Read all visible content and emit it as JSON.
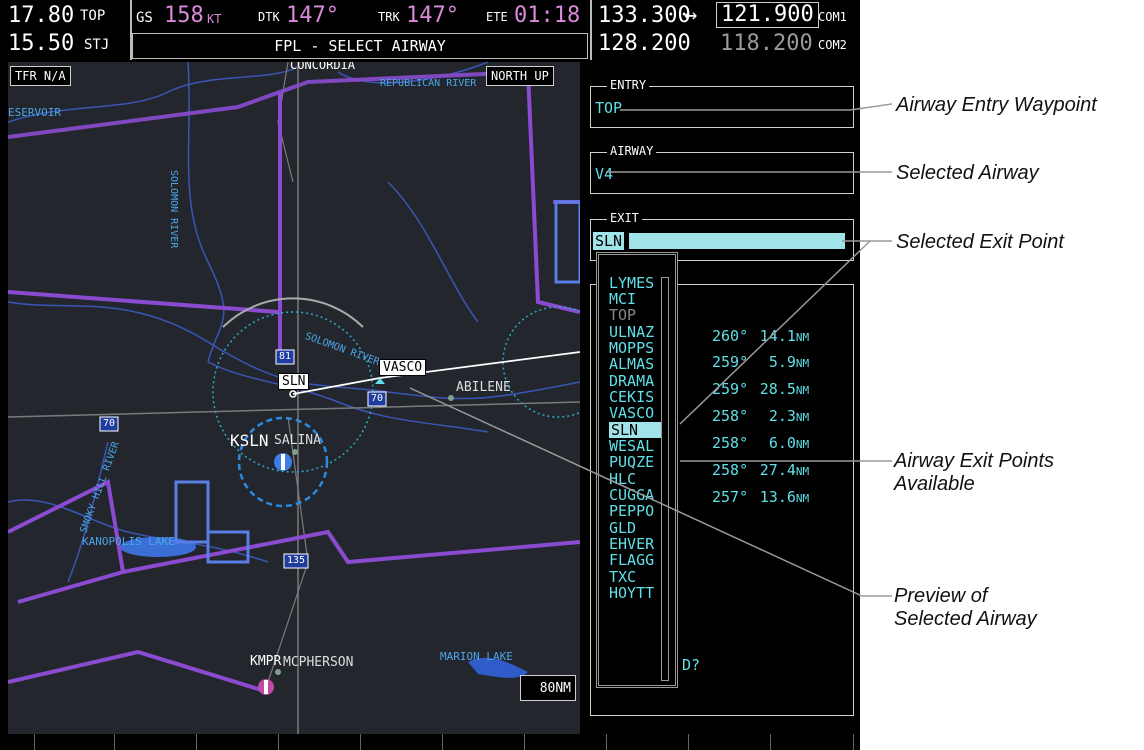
{
  "nav": {
    "dest_speed": "17.80",
    "dest_speed_sub": "15.50",
    "wpt_from": "TOP",
    "wpt_to": "STJ",
    "gs_label": "GS",
    "gs_value": "158",
    "gs_unit": "KT",
    "dtk_label": "DTK",
    "dtk_value": "147°",
    "trk_label": "TRK",
    "trk_value": "147°",
    "ete_label": "ETE",
    "ete_value": "01:18",
    "page_title": "FPL - SELECT AIRWAY"
  },
  "comm": {
    "com1_active": "133.300",
    "arrows": "↔",
    "com1_standby": "121.900",
    "com1_label": "COM1",
    "com2_active": "128.200",
    "com2_standby": "118.200",
    "com2_label": "COM2"
  },
  "map": {
    "tfr": "TFR N/A",
    "orientation": "NORTH UP",
    "scale": "80NM",
    "labels": {
      "concordia": "CONCORDIA",
      "republican_river": "REPUBLICAN RIVER",
      "reservoir": "ESERVOIR",
      "solomon_river": "SOLOMON RIVER",
      "solomon_river2": "SOLOMON RIVER",
      "abilene": "ABILENE",
      "ksln": "KSLN",
      "salina": "SALINA",
      "kanopolis": "KANOPOLIS LAKE",
      "smoky": "SMOKY HILL RIVER",
      "kmpr": "KMPR",
      "mcpherson": "MCPHERSON",
      "marion": "MARION LAKE",
      "sln_tag": "SLN",
      "vasco_tag": "VASCO",
      "hwy81": "81",
      "hwy70a": "70",
      "hwy70b": "70",
      "hwy135": "135"
    }
  },
  "panel": {
    "entry_title": "ENTRY",
    "entry_value": "TOP",
    "airway_title": "AIRWAY",
    "airway_value": "V4",
    "exit_title": "EXIT",
    "exit_value": "SLN",
    "rows": [
      {
        "brg": "260°",
        "dist": "14.1",
        "unit": "NM"
      },
      {
        "brg": "259°",
        "dist": "5.9",
        "unit": "NM"
      },
      {
        "brg": "259°",
        "dist": "28.5",
        "unit": "NM"
      },
      {
        "brg": "258°",
        "dist": "2.3",
        "unit": "NM"
      },
      {
        "brg": "258°",
        "dist": "6.0",
        "unit": "NM"
      },
      {
        "brg": "258°",
        "dist": "27.4",
        "unit": "NM"
      },
      {
        "brg": "257°",
        "dist": "13.6",
        "unit": "NM"
      }
    ],
    "load_suffix": "D?"
  },
  "popup": {
    "items": [
      "LYMES",
      "MCI",
      "TOP",
      "ULNAZ",
      "MOPPS",
      "ALMAS",
      "DRAMA",
      "CEKIS",
      "VASCO",
      "SLN",
      "WESAL",
      "PUQZE",
      "HLC",
      "CUGGA",
      "PEPPO",
      "GLD",
      "EHVER",
      "FLAGG",
      "TXC",
      "HOYTT"
    ]
  },
  "callouts": {
    "entry": "Airway Entry Waypoint",
    "airway": "Selected Airway",
    "exit": "Selected Exit Point",
    "available_1": "Airway Exit Points",
    "available_2": "Available",
    "preview_1": "Preview of",
    "preview_2": "Selected Airway"
  },
  "colors": {
    "cyan": "#5fe0e8",
    "magenta": "#d98ad9",
    "selection": "#a0e4ea",
    "map_bg": "#23272d",
    "airway_purple": "#8a4bd0",
    "water_blue": "#3b6fd6"
  }
}
